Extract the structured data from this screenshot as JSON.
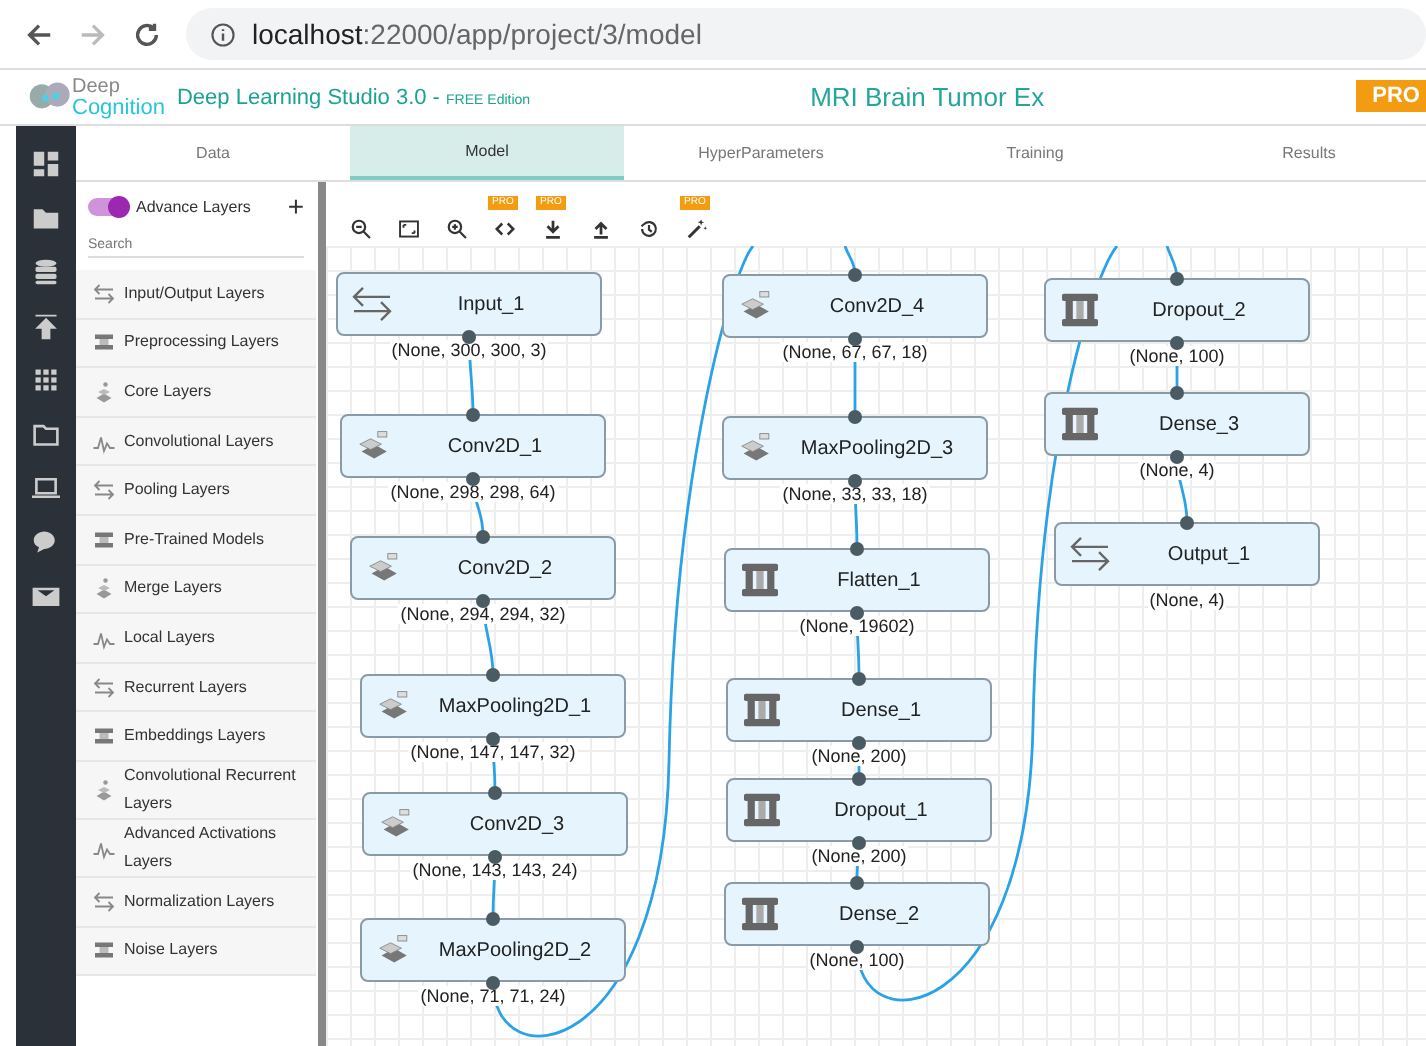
{
  "browser": {
    "host": "localhost",
    "path": ":22000/app/project/3/model"
  },
  "app": {
    "logo_top": "Deep",
    "logo_bottom": "Cognition",
    "title": "Deep Learning Studio 3.0 - ",
    "edition": "FREE Edition",
    "project": "MRI Brain Tumor Ex",
    "pro_badge": "PRO"
  },
  "tabs": [
    {
      "label": "Data",
      "selected": false
    },
    {
      "label": "Model",
      "selected": true
    },
    {
      "label": "HyperParameters",
      "selected": false
    },
    {
      "label": "Training",
      "selected": false
    },
    {
      "label": "Results",
      "selected": false
    }
  ],
  "layers_panel": {
    "toggle": {
      "label": "Advance Layers",
      "on": true
    },
    "add": "+",
    "search": {
      "placeholder": "Search"
    },
    "items": [
      {
        "label": "Input/Output Layers"
      },
      {
        "label": "Preprocessing Layers"
      },
      {
        "label": "Core Layers"
      },
      {
        "label": "Convolutional Layers"
      },
      {
        "label": "Pooling Layers"
      },
      {
        "label": "Pre-Trained Models"
      },
      {
        "label": "Merge Layers"
      },
      {
        "label": "Local Layers"
      },
      {
        "label": "Recurrent Layers"
      },
      {
        "label": "Embeddings Layers"
      },
      {
        "label": "Convolutional Recurrent Layers"
      },
      {
        "label": "Advanced Activations Layers"
      },
      {
        "label": "Normalization Layers"
      },
      {
        "label": "Noise Layers"
      }
    ]
  },
  "toolbar": [
    {
      "kind": "zoom-out"
    },
    {
      "kind": "fit"
    },
    {
      "kind": "zoom-in"
    },
    {
      "kind": "code",
      "pro_badge": "PRO"
    },
    {
      "kind": "download",
      "pro_badge": "PRO"
    },
    {
      "kind": "upload"
    },
    {
      "kind": "history"
    },
    {
      "kind": "wand",
      "pro_badge": "PRO"
    }
  ],
  "nodes": [
    {
      "name": "Input_1",
      "shape": "(None, 300, 300, 3)",
      "kind": "io"
    },
    {
      "name": "Conv2D_1",
      "shape": "(None, 298, 298, 64)",
      "kind": "conv"
    },
    {
      "name": "Conv2D_2",
      "shape": "(None, 294, 294, 32)",
      "kind": "conv"
    },
    {
      "name": "MaxPooling2D_1",
      "shape": "(None, 147, 147, 32)",
      "kind": "conv"
    },
    {
      "name": "Conv2D_3",
      "shape": "(None, 143, 143, 24)",
      "kind": "conv"
    },
    {
      "name": "MaxPooling2D_2",
      "shape": "(None, 71, 71, 24)",
      "kind": "conv"
    },
    {
      "name": "Conv2D_4",
      "shape": "(None, 67, 67, 18)",
      "kind": "conv"
    },
    {
      "name": "MaxPooling2D_3",
      "shape": "(None, 33, 33, 18)",
      "kind": "conv"
    },
    {
      "name": "Flatten_1",
      "shape": "(None, 19602)",
      "kind": "core"
    },
    {
      "name": "Dense_1",
      "shape": "(None, 200)",
      "kind": "core"
    },
    {
      "name": "Dropout_1",
      "shape": "(None, 200)",
      "kind": "core"
    },
    {
      "name": "Dense_2",
      "shape": "(None, 100)",
      "kind": "core"
    },
    {
      "name": "Dropout_2",
      "shape": "(None, 100)",
      "kind": "core"
    },
    {
      "name": "Dense_3",
      "shape": "(None, 4)",
      "kind": "core"
    },
    {
      "name": "Output_1",
      "shape": "(None, 4)",
      "kind": "io"
    }
  ]
}
